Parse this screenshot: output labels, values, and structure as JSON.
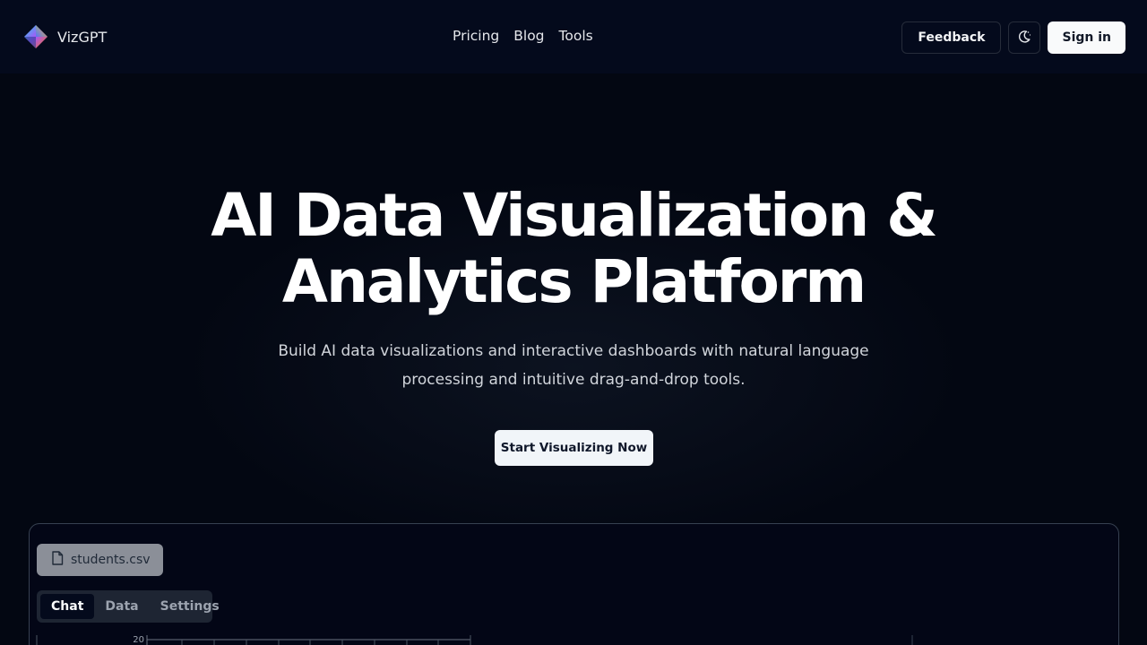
{
  "header": {
    "brand": "VizGPT",
    "nav": [
      "Pricing",
      "Blog",
      "Tools"
    ],
    "feedback_label": "Feedback",
    "theme_icon": "moon-icon",
    "signin_label": "Sign in"
  },
  "hero": {
    "title_line1": "AI Data Visualization &",
    "title_line2": "Analytics Platform",
    "subtitle_line1": "Build AI data visualizations and interactive dashboards with natural language",
    "subtitle_line2": "processing and intuitive drag-and-drop tools.",
    "cta_label": "Start Visualizing Now"
  },
  "preview": {
    "file_name": "students.csv",
    "file_icon": "file-icon",
    "tabs": [
      {
        "label": "Chat",
        "active": true
      },
      {
        "label": "Data",
        "active": false
      },
      {
        "label": "Settings",
        "active": false
      }
    ],
    "chart_y_tick": "20"
  },
  "colors": {
    "background": "#030712",
    "primary_button": "#f1f5f9"
  }
}
